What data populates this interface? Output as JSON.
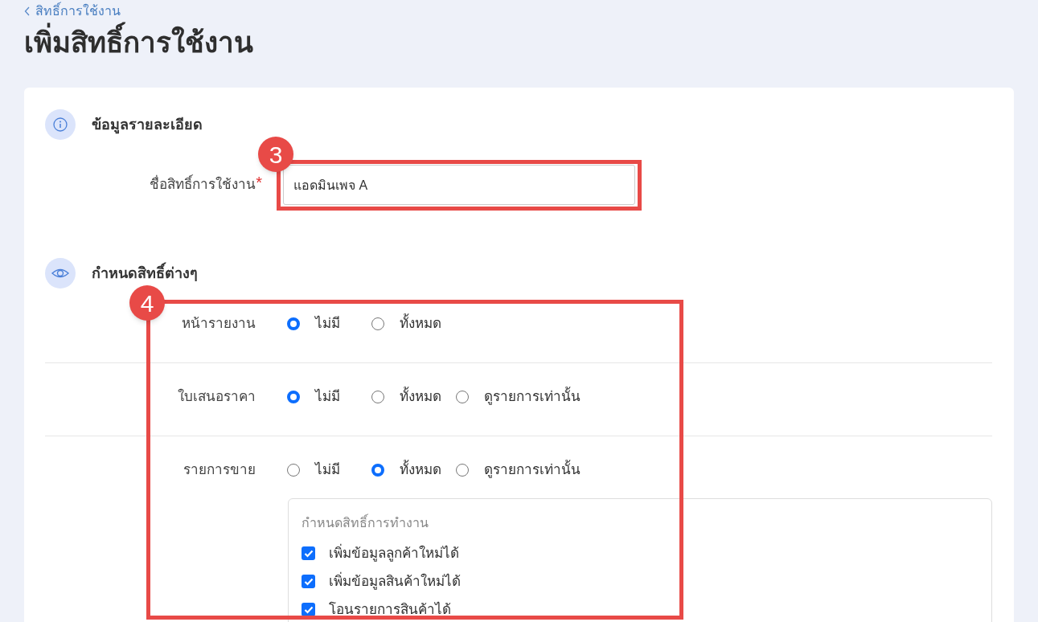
{
  "breadcrumb": {
    "label": "สิทธิ์การใช้งาน"
  },
  "title": "เพิ่มสิทธิ์การใช้งาน",
  "details_section": {
    "heading": "ข้อมูลรายละเอียด",
    "field": {
      "label": "ชื่อสิทธิ์การใช้งาน",
      "required_mark": "*",
      "value": "แอดมินเพจ A"
    }
  },
  "permissions_section": {
    "heading": "กำหนดสิทธิ์ต่างๆ",
    "rows": [
      {
        "label": "หน้ารายงาน",
        "options": [
          {
            "label": "ไม่มี",
            "selected": true
          },
          {
            "label": "ทั้งหมด",
            "selected": false
          }
        ]
      },
      {
        "label": "ใบเสนอราคา",
        "options": [
          {
            "label": "ไม่มี",
            "selected": true
          },
          {
            "label": "ทั้งหมด",
            "selected": false
          },
          {
            "label": "ดูรายการเท่านั้น",
            "selected": false
          }
        ]
      },
      {
        "label": "รายการขาย",
        "options": [
          {
            "label": "ไม่มี",
            "selected": false
          },
          {
            "label": "ทั้งหมด",
            "selected": true
          },
          {
            "label": "ดูรายการเท่านั้น",
            "selected": false
          }
        ],
        "sub_permissions": {
          "title": "กำหนดสิทธิ์การทำงาน",
          "items": [
            {
              "label": "เพิ่มข้อมูลลูกค้าใหม่ได้",
              "checked": true
            },
            {
              "label": "เพิ่มข้อมูลสินค้าใหม่ได้",
              "checked": true
            },
            {
              "label": "โอนรายการสินค้าได้",
              "checked": true
            }
          ]
        }
      }
    ]
  },
  "annotations": [
    {
      "marker": "3"
    },
    {
      "marker": "4"
    }
  ]
}
